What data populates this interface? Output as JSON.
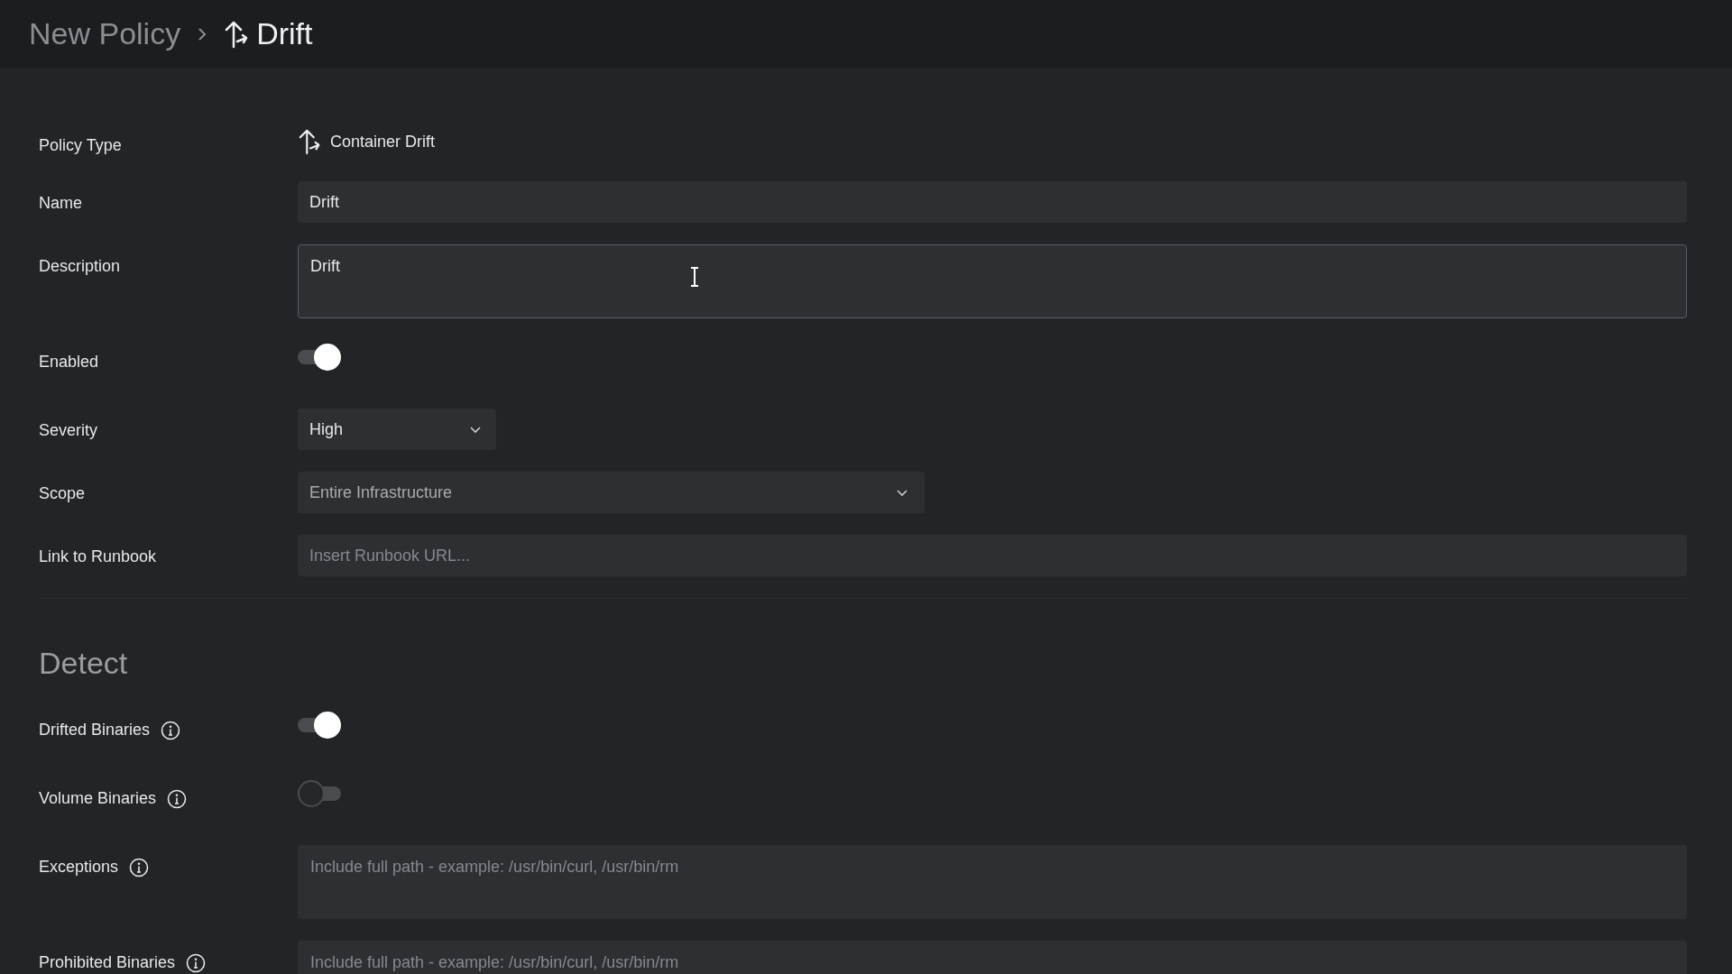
{
  "breadcrumb": {
    "parent": "New Policy",
    "current": "Drift"
  },
  "general": [
    {
      "kind": "static",
      "label": "Policy Type",
      "value": "Container Drift"
    },
    {
      "kind": "text",
      "label": "Name",
      "value": "Drift"
    },
    {
      "kind": "textarea",
      "label": "Description",
      "value": "Drift",
      "focused": true
    },
    {
      "kind": "toggle",
      "label": "Enabled",
      "on": true
    },
    {
      "kind": "select",
      "label": "Severity",
      "value": "High",
      "wide": false
    },
    {
      "kind": "select",
      "label": "Scope",
      "value": "Entire Infrastructure",
      "wide": true,
      "muted": true
    },
    {
      "kind": "text",
      "label": "Link to Runbook",
      "placeholder": "Insert Runbook URL..."
    }
  ],
  "detect": {
    "title": "Detect",
    "fields": [
      {
        "kind": "toggle",
        "label": "Drifted Binaries",
        "on": true
      },
      {
        "kind": "toggle",
        "label": "Volume Binaries",
        "on": false
      },
      {
        "kind": "textarea",
        "label": "Exceptions",
        "placeholder": "Include full path - example: /usr/bin/curl, /usr/bin/rm",
        "focused": false
      },
      {
        "kind": "textarea",
        "label": "Prohibited Binaries",
        "placeholder": "Include full path - example: /usr/bin/curl, /usr/bin/rm",
        "focused": false
      }
    ]
  }
}
